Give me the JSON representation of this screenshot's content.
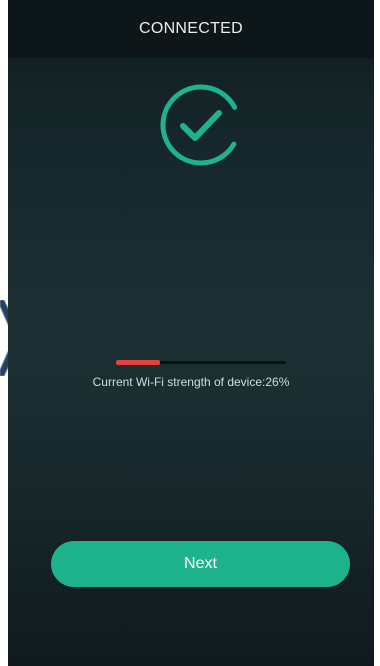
{
  "header": {
    "title": "CONNECTED"
  },
  "status": {
    "icon": "check-circle-icon",
    "color": "#1db48d"
  },
  "wifi": {
    "strength_label": "Current Wi-Fi strength of device:26%",
    "strength_fraction": 0.26,
    "bar_color": "#e0443d"
  },
  "actions": {
    "next_label": "Next",
    "button_color": "#1db48d"
  }
}
